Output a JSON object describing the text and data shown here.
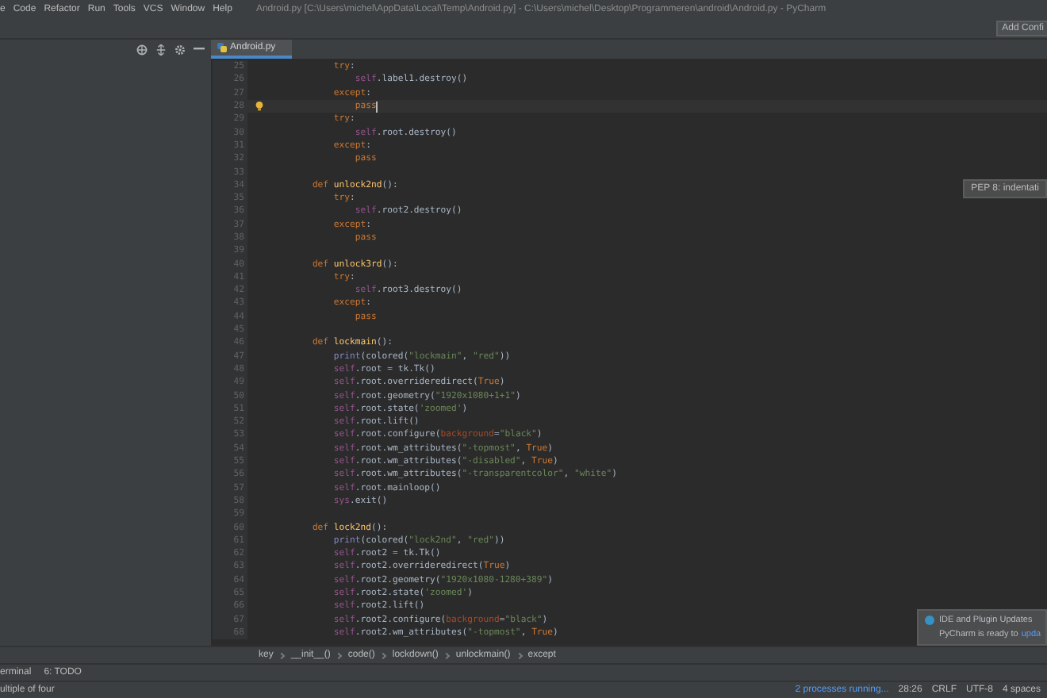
{
  "menu": [
    "e",
    "Code",
    "Refactor",
    "Run",
    "Tools",
    "VCS",
    "Window",
    "Help"
  ],
  "window": {
    "title": "Android.py [C:\\Users\\michel\\AppData\\Local\\Temp\\Android.py] - C:\\Users\\michel\\Desktop\\Programmeren\\android\\Android.py - PyCharm"
  },
  "toolbar": {
    "run_config_button": "Add Confi"
  },
  "tabs": [
    {
      "label": "Android.py",
      "selected": true
    }
  ],
  "editor": {
    "lines": [
      {
        "num": "25",
        "current": false,
        "tokens": [
          {
            "kind": "kw",
            "text": "            try"
          },
          {
            "kind": "plain",
            "text": ":"
          }
        ]
      },
      {
        "num": "26",
        "current": false,
        "tokens": [
          {
            "kind": "self",
            "text": "                self"
          },
          {
            "kind": "plain",
            "text": ".label1.destroy()"
          }
        ]
      },
      {
        "num": "27",
        "current": false,
        "tokens": [
          {
            "kind": "kw",
            "text": "            except"
          },
          {
            "kind": "plain",
            "text": ":"
          }
        ]
      },
      {
        "num": "28",
        "current": true,
        "tokens": [
          {
            "kind": "kw",
            "text": "                pass"
          }
        ]
      },
      {
        "num": "29",
        "current": false,
        "tokens": [
          {
            "kind": "kw",
            "text": "            try"
          },
          {
            "kind": "plain",
            "text": ":"
          }
        ]
      },
      {
        "num": "30",
        "current": false,
        "tokens": [
          {
            "kind": "self",
            "text": "                self"
          },
          {
            "kind": "plain",
            "text": ".root.destroy()"
          }
        ]
      },
      {
        "num": "31",
        "current": false,
        "tokens": [
          {
            "kind": "kw",
            "text": "            except"
          },
          {
            "kind": "plain",
            "text": ":"
          }
        ]
      },
      {
        "num": "32",
        "current": false,
        "tokens": [
          {
            "kind": "kw",
            "text": "                pass"
          }
        ]
      },
      {
        "num": "33",
        "current": false
      },
      {
        "num": "34",
        "current": false,
        "tokens": [
          {
            "kind": "kw",
            "text": "        def"
          },
          {
            "kind": "fname",
            "text": " unlock2nd"
          },
          {
            "kind": "plain",
            "text": "():"
          }
        ]
      },
      {
        "num": "35",
        "current": false,
        "tokens": [
          {
            "kind": "kw",
            "text": "            try"
          },
          {
            "kind": "plain",
            "text": ":"
          }
        ]
      },
      {
        "num": "36",
        "current": false,
        "tokens": [
          {
            "kind": "self",
            "text": "                self"
          },
          {
            "kind": "plain",
            "text": ".root2.destroy()"
          }
        ]
      },
      {
        "num": "37",
        "current": false,
        "tokens": [
          {
            "kind": "kw",
            "text": "            except"
          },
          {
            "kind": "plain",
            "text": ":"
          }
        ]
      },
      {
        "num": "38",
        "current": false,
        "tokens": [
          {
            "kind": "kw",
            "text": "                pass"
          }
        ]
      },
      {
        "num": "39",
        "current": false
      },
      {
        "num": "40",
        "current": false,
        "tokens": [
          {
            "kind": "kw",
            "text": "        def"
          },
          {
            "kind": "fname",
            "text": " unlock3rd"
          },
          {
            "kind": "plain",
            "text": "():"
          }
        ]
      },
      {
        "num": "41",
        "current": false,
        "tokens": [
          {
            "kind": "kw",
            "text": "            try"
          },
          {
            "kind": "plain",
            "text": ":"
          }
        ]
      },
      {
        "num": "42",
        "current": false,
        "tokens": [
          {
            "kind": "self",
            "text": "                self"
          },
          {
            "kind": "plain",
            "text": ".root3.destroy()"
          }
        ]
      },
      {
        "num": "43",
        "current": false,
        "tokens": [
          {
            "kind": "kw",
            "text": "            except"
          },
          {
            "kind": "plain",
            "text": ":"
          }
        ]
      },
      {
        "num": "44",
        "current": false,
        "tokens": [
          {
            "kind": "kw",
            "text": "                pass"
          }
        ]
      },
      {
        "num": "45",
        "current": false
      },
      {
        "num": "46",
        "current": false,
        "tokens": [
          {
            "kind": "kw",
            "text": "        def"
          },
          {
            "kind": "fname",
            "text": " lockmain"
          },
          {
            "kind": "plain",
            "text": "():"
          }
        ]
      },
      {
        "num": "47",
        "current": false,
        "tokens": [
          {
            "kind": "builtin",
            "text": "            print"
          },
          {
            "kind": "plain",
            "text": "(colored("
          },
          {
            "kind": "str",
            "text": "\"lockmain\""
          },
          {
            "kind": "plain",
            "text": ", "
          },
          {
            "kind": "str",
            "text": "\"red\""
          },
          {
            "kind": "plain",
            "text": "))"
          }
        ]
      },
      {
        "num": "48",
        "current": false,
        "tokens": [
          {
            "kind": "self",
            "text": "            self"
          },
          {
            "kind": "plain",
            "text": ".root = tk.Tk()"
          }
        ]
      },
      {
        "num": "49",
        "current": false,
        "tokens": [
          {
            "kind": "self",
            "text": "            self"
          },
          {
            "kind": "plain",
            "text": ".root.overrideredirect("
          },
          {
            "kind": "kw",
            "text": "True"
          },
          {
            "kind": "plain",
            "text": ")"
          }
        ]
      },
      {
        "num": "50",
        "current": false,
        "tokens": [
          {
            "kind": "self",
            "text": "            self"
          },
          {
            "kind": "plain",
            "text": ".root.geometry("
          },
          {
            "kind": "str",
            "text": "\"1920x1080+1+1\""
          },
          {
            "kind": "plain",
            "text": ")"
          }
        ]
      },
      {
        "num": "51",
        "current": false,
        "tokens": [
          {
            "kind": "self",
            "text": "            self"
          },
          {
            "kind": "plain",
            "text": ".root.state("
          },
          {
            "kind": "str",
            "text": "'zoomed'"
          },
          {
            "kind": "plain",
            "text": ")"
          }
        ]
      },
      {
        "num": "52",
        "current": false,
        "tokens": [
          {
            "kind": "self",
            "text": "            self"
          },
          {
            "kind": "plain",
            "text": ".root.lift()"
          }
        ]
      },
      {
        "num": "53",
        "current": false,
        "tokens": [
          {
            "kind": "self",
            "text": "            self"
          },
          {
            "kind": "plain",
            "text": ".root.configure("
          },
          {
            "kind": "param",
            "text": "background"
          },
          {
            "kind": "plain",
            "text": "="
          },
          {
            "kind": "str",
            "text": "\"black\""
          },
          {
            "kind": "plain",
            "text": ")"
          }
        ]
      },
      {
        "num": "54",
        "current": false,
        "tokens": [
          {
            "kind": "self",
            "text": "            self"
          },
          {
            "kind": "plain",
            "text": ".root.wm_attributes("
          },
          {
            "kind": "str",
            "text": "\"-topmost\""
          },
          {
            "kind": "plain",
            "text": ", "
          },
          {
            "kind": "kw",
            "text": "True"
          },
          {
            "kind": "plain",
            "text": ")"
          }
        ]
      },
      {
        "num": "55",
        "current": false,
        "tokens": [
          {
            "kind": "self",
            "text": "            self"
          },
          {
            "kind": "plain",
            "text": ".root.wm_attributes("
          },
          {
            "kind": "str",
            "text": "\"-disabled\""
          },
          {
            "kind": "plain",
            "text": ", "
          },
          {
            "kind": "kw",
            "text": "True"
          },
          {
            "kind": "plain",
            "text": ")"
          }
        ]
      },
      {
        "num": "56",
        "current": false,
        "tokens": [
          {
            "kind": "self",
            "text": "            self"
          },
          {
            "kind": "plain",
            "text": ".root.wm_attributes("
          },
          {
            "kind": "str",
            "text": "\"-transparentcolor\""
          },
          {
            "kind": "plain",
            "text": ", "
          },
          {
            "kind": "str",
            "text": "\"white\""
          },
          {
            "kind": "plain",
            "text": ")"
          }
        ]
      },
      {
        "num": "57",
        "current": false,
        "tokens": [
          {
            "kind": "self",
            "text": "            self"
          },
          {
            "kind": "plain",
            "text": ".root.mainloop()"
          }
        ]
      },
      {
        "num": "58",
        "current": false,
        "tokens": [
          {
            "kind": "self",
            "text": "            sys"
          },
          {
            "kind": "plain",
            "text": ".exit()"
          }
        ]
      },
      {
        "num": "59",
        "current": false
      },
      {
        "num": "60",
        "current": false,
        "tokens": [
          {
            "kind": "kw",
            "text": "        def"
          },
          {
            "kind": "fname",
            "text": " lock2nd"
          },
          {
            "kind": "plain",
            "text": "():"
          }
        ]
      },
      {
        "num": "61",
        "current": false,
        "tokens": [
          {
            "kind": "builtin",
            "text": "            print"
          },
          {
            "kind": "plain",
            "text": "(colored("
          },
          {
            "kind": "str",
            "text": "\"lock2nd\""
          },
          {
            "kind": "plain",
            "text": ", "
          },
          {
            "kind": "str",
            "text": "\"red\""
          },
          {
            "kind": "plain",
            "text": "))"
          }
        ]
      },
      {
        "num": "62",
        "current": false,
        "tokens": [
          {
            "kind": "self",
            "text": "            self"
          },
          {
            "kind": "plain",
            "text": ".root2 = tk.Tk()"
          }
        ]
      },
      {
        "num": "63",
        "current": false,
        "tokens": [
          {
            "kind": "self",
            "text": "            self"
          },
          {
            "kind": "plain",
            "text": ".root2.overrideredirect("
          },
          {
            "kind": "kw",
            "text": "True"
          },
          {
            "kind": "plain",
            "text": ")"
          }
        ]
      },
      {
        "num": "64",
        "current": false,
        "tokens": [
          {
            "kind": "self",
            "text": "            self"
          },
          {
            "kind": "plain",
            "text": ".root2.geometry("
          },
          {
            "kind": "str",
            "text": "\"1920x1080-1280+389\""
          },
          {
            "kind": "plain",
            "text": ")"
          }
        ]
      },
      {
        "num": "65",
        "current": false,
        "tokens": [
          {
            "kind": "self",
            "text": "            self"
          },
          {
            "kind": "plain",
            "text": ".root2.state("
          },
          {
            "kind": "str",
            "text": "'zoomed'"
          },
          {
            "kind": "plain",
            "text": ")"
          }
        ]
      },
      {
        "num": "66",
        "current": false,
        "tokens": [
          {
            "kind": "self",
            "text": "            self"
          },
          {
            "kind": "plain",
            "text": ".root2.lift()"
          }
        ]
      },
      {
        "num": "67",
        "current": false,
        "tokens": [
          {
            "kind": "self",
            "text": "            self"
          },
          {
            "kind": "plain",
            "text": ".root2.configure("
          },
          {
            "kind": "param",
            "text": "background"
          },
          {
            "kind": "plain",
            "text": "="
          },
          {
            "kind": "str",
            "text": "\"black\""
          },
          {
            "kind": "plain",
            "text": ")"
          }
        ]
      },
      {
        "num": "68",
        "current": false,
        "tokens": [
          {
            "kind": "self",
            "text": "            self"
          },
          {
            "kind": "plain",
            "text": ".root2.wm_attributes("
          },
          {
            "kind": "str",
            "text": "\"-topmost\""
          },
          {
            "kind": "plain",
            "text": ", "
          },
          {
            "kind": "kw",
            "text": "True"
          },
          {
            "kind": "plain",
            "text": ")"
          }
        ]
      }
    ]
  },
  "tooltip": "PEP 8: indentati",
  "notification": {
    "title": "IDE and Plugin Updates",
    "text": "PyCharm is ready to",
    "link": "upda"
  },
  "breadcrumbs": [
    "key",
    "__init__()",
    "code()",
    "lockdown()",
    "unlockmain()",
    "except"
  ],
  "tool_windows": [
    "erminal",
    "6: TODO"
  ],
  "status_bar": {
    "message": "ultiple of four",
    "processes": "2 processes running...",
    "position": "28:26",
    "line_sep": "CRLF",
    "encoding": "UTF-8",
    "indent": "4 spaces"
  }
}
